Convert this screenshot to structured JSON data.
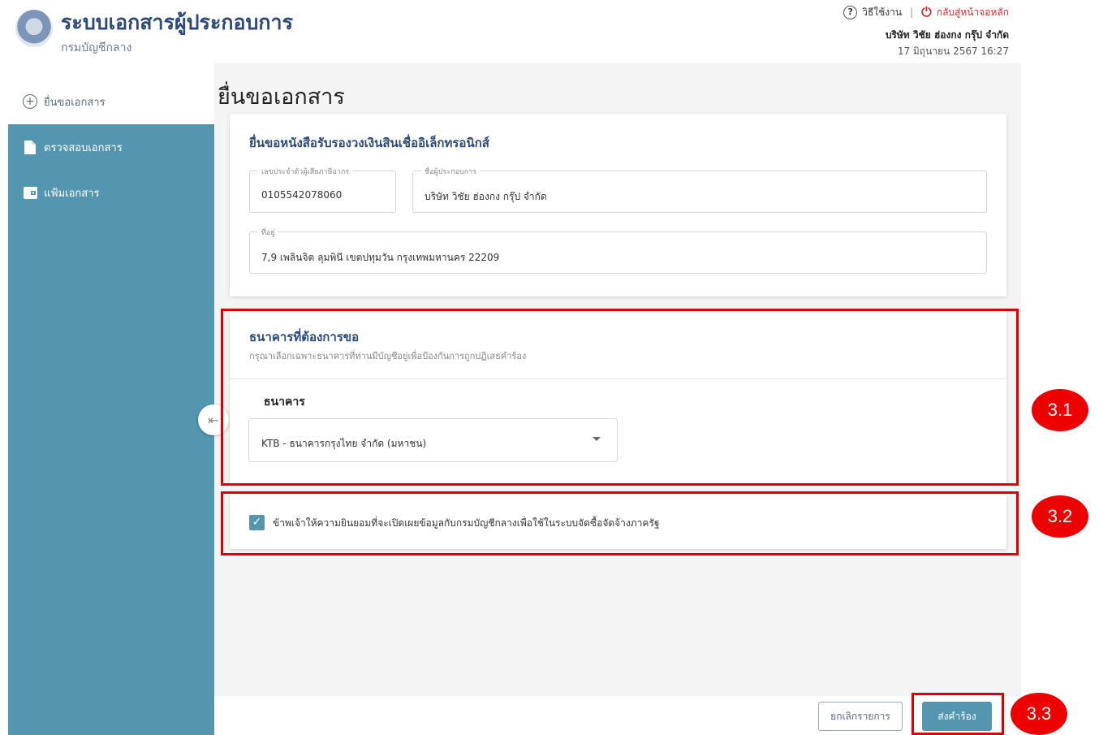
{
  "header": {
    "app_title": "ระบบเอกสารผู้ประกอบการ",
    "app_subtitle": "กรมบัญชีกลาง",
    "help_label": "วิธีใช้งาน",
    "separator": "|",
    "home_label": "กลับสู่หน้าจอหลัก",
    "company": "บริษัท วิชัย ฮ่องกง กรุ๊ป จำกัด",
    "datetime": "17 มิถุนายน 2567 16:27"
  },
  "sidebar": {
    "items": [
      {
        "label": "ยื่นขอเอกสาร",
        "icon": "plus-circle-icon"
      },
      {
        "label": "ตรวจสอบเอกสาร",
        "icon": "document-icon"
      },
      {
        "label": "แฟ้มเอกสาร",
        "icon": "wallet-icon"
      }
    ],
    "collapse_glyph": "⇤"
  },
  "page": {
    "title": "ยื่นขอเอกสาร"
  },
  "applicant_card": {
    "title": "ยื่นขอหนังสือรับรองวงเงินสินเชื่ออิเล็กทรอนิกส์",
    "tax_id_label": "เลขประจำตัวผู้เสียภาษีอากร",
    "tax_id_value": "0105542078060",
    "company_label": "ชื่อผู้ประกอบการ",
    "company_value": "บริษัท วิชัย ฮ่องกง กรุ๊ป จำกัด",
    "address_label": "ที่อยู่",
    "address_value": "7,9 เพลินจิต ลุมพินี เขตปทุมวัน กรุงเทพมหานคร 22209"
  },
  "bank_card": {
    "title": "ธนาคารที่ต้องการขอ",
    "subtitle": "กรุณาเลือกเฉพาะธนาคารที่ท่านมีบัญชีอยู่เพื่อป้องกันการถูกปฏิเสธคำร้อง",
    "bank_label": "ธนาคาร",
    "bank_selected": "KTB - ธนาคารกรุงไทย จำกัด (มหาชน)"
  },
  "consent": {
    "checked": true,
    "check_glyph": "✓",
    "text": "ข้าพเจ้าให้ความยินยอมที่จะเปิดเผยข้อมูลกับกรมบัญชีกลางเพื่อใช้ในระบบจัดซื้อจัดจ้างภาครัฐ"
  },
  "footer": {
    "cancel_label": "ยกเลิกรายการ",
    "submit_label": "ส่งคำร้อง"
  },
  "annotations": {
    "badge_1": "3.1",
    "badge_2": "3.2",
    "badge_3": "3.3",
    "highlight_color": "#e00000"
  },
  "colors": {
    "sidebar": "#5496b0",
    "primary_text": "#2a4a7c",
    "danger": "#d32f2f"
  }
}
